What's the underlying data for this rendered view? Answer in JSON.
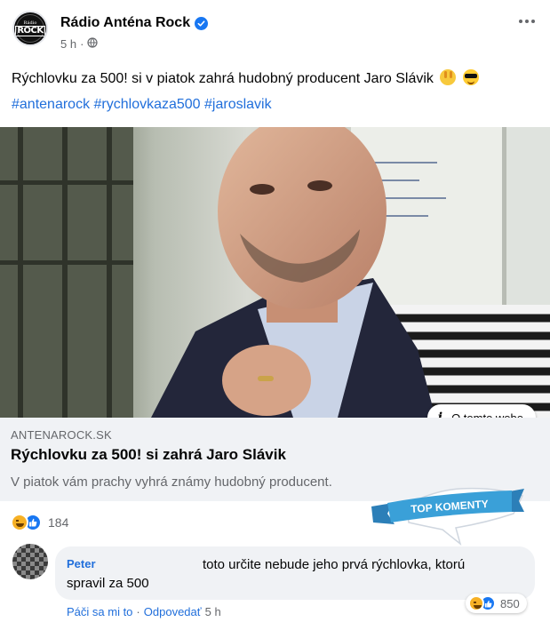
{
  "post": {
    "page_name": "Rádio Anténa Rock",
    "time": "5 h",
    "separator": "·",
    "text": "Rýchlovku za 500! si v piatok zahrá hudobný producent Jaro Slávik",
    "hashtags": "#antenarock #rychlovkaza500 #jaroslavik",
    "avatar_logo_small": "Rádio",
    "avatar_logo_big": "ROCK"
  },
  "link_preview": {
    "info_badge": "O tomto webe",
    "domain": "ANTENAROCK.SK",
    "title": "Rýchlovku za 500! si zahrá Jaro Slávik",
    "description": "V piatok vám prachy vyhrá známy hudobný producent."
  },
  "ribbon": {
    "label": "TOP KOMENTY",
    "color": "#3aa0d8"
  },
  "reactions": {
    "count": "184"
  },
  "comment": {
    "author": "Peter",
    "text_line1": "toto určite nebude jeho prvá rýchlovka, ktorú",
    "text_line2": "spravil za 500",
    "reaction_count": "850",
    "like_label": "Páči sa mi to",
    "reply_label": "Odpovedať",
    "separator": "·",
    "time": "5 h"
  },
  "colors": {
    "link_blue": "#216fdb",
    "like_blue": "#1877f2",
    "secondary_text": "#65676b",
    "bubble_bg": "#f0f2f5"
  }
}
